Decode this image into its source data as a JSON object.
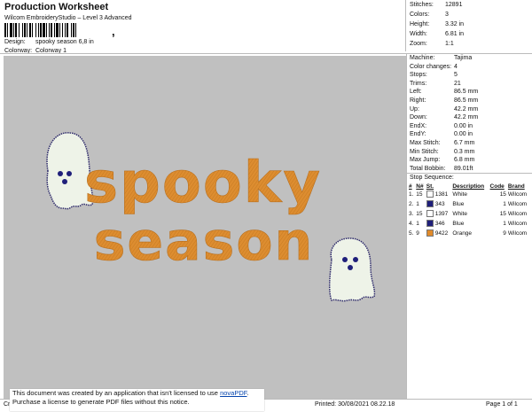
{
  "header": {
    "title": "Production Worksheet",
    "subtitle": "Wilcom EmbroideryStudio – Level 3 Advanced",
    "barcode_suffix": ",",
    "design_label": "Design:",
    "design_value": "spooky season 6,8 in",
    "colorway_label": "Colorway:",
    "colorway_value": "Colorway 1"
  },
  "summary": {
    "stitches_label": "Stitches:",
    "stitches": "12891",
    "colors_label": "Colors:",
    "colors": "3",
    "height_label": "Height:",
    "height": "3.32 in",
    "width_label": "Width:",
    "width": "6.81 in",
    "zoom_label": "Zoom:",
    "zoom": "1:1"
  },
  "design_text": {
    "line1": "spooky",
    "line2": "season"
  },
  "colors": {
    "canvas": "#c0c0c0",
    "orange": "#d98a2c",
    "ghost_fill": "#eef3e8",
    "ghost_outline": "#2e2a6b",
    "blue": "#1f1f7a"
  },
  "machine": [
    {
      "k": "Machine:",
      "v": "Tajima"
    },
    {
      "k": "Color changes:",
      "v": "4"
    },
    {
      "k": "Stops:",
      "v": "5"
    },
    {
      "k": "Trims:",
      "v": "21"
    },
    {
      "k": "Left:",
      "v": "86.5 mm"
    },
    {
      "k": "Right:",
      "v": "86.5 mm"
    },
    {
      "k": "Up:",
      "v": "42.2 mm"
    },
    {
      "k": "Down:",
      "v": "42.2 mm"
    },
    {
      "k": "EndX:",
      "v": "0.00 in"
    },
    {
      "k": "EndY:",
      "v": "0.00 in"
    },
    {
      "k": "Max Stitch:",
      "v": "6.7 mm"
    },
    {
      "k": "Min Stitch:",
      "v": "0.3 mm"
    },
    {
      "k": "Max Jump:",
      "v": "6.8 mm"
    },
    {
      "k": "Total Bobbin:",
      "v": "89.01ft"
    }
  ],
  "stop_sequence": {
    "label": "Stop Sequence:",
    "headers": [
      "#",
      "N#",
      "St.",
      "Description",
      "Code",
      "Brand"
    ],
    "rows": [
      {
        "idx": "1.",
        "n": "15",
        "st": "1381",
        "desc": "White",
        "code": "15",
        "brand": "Wilcom",
        "color": "#ffffff"
      },
      {
        "idx": "2.",
        "n": "1",
        "st": "343",
        "desc": "Blue",
        "code": "1",
        "brand": "Wilcom",
        "color": "#1f1f7a"
      },
      {
        "idx": "3.",
        "n": "15",
        "st": "1397",
        "desc": "White",
        "code": "15",
        "brand": "Wilcom",
        "color": "#ffffff"
      },
      {
        "idx": "4.",
        "n": "1",
        "st": "346",
        "desc": "Blue",
        "code": "1",
        "brand": "Wilcom",
        "color": "#1f1f7a"
      },
      {
        "idx": "5.",
        "n": "9",
        "st": "9422",
        "desc": "Orange",
        "code": "9",
        "brand": "Wilcom",
        "color": "#e08a2a"
      }
    ]
  },
  "footer": {
    "left": "Cr",
    "printed": "Printed: 30/08/2021 08.22.18",
    "page": "Page 1 of 1"
  },
  "notice": {
    "line1": "This document was created by an application that isn't licensed to use",
    "link": "novaPDF",
    "line1_end": ".",
    "line2": "Purchase a license to generate PDF files without this notice."
  }
}
